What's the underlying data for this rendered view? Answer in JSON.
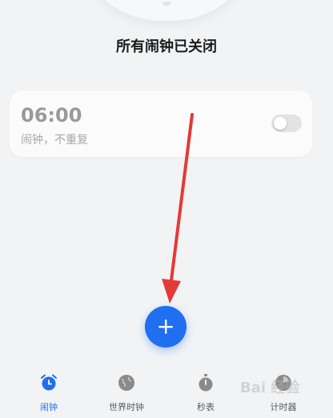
{
  "status": {
    "title": "所有闹钟已关闭"
  },
  "alarm": {
    "time": "06:00",
    "subtitle": "闹钟，不重复",
    "enabled": false
  },
  "add_button": {
    "icon": "plus-icon"
  },
  "tabs": [
    {
      "label": "闹钟",
      "icon": "alarm-clock-icon",
      "active": true
    },
    {
      "label": "世界时钟",
      "icon": "globe-icon",
      "active": false
    },
    {
      "label": "秒表",
      "icon": "stopwatch-icon",
      "active": false
    },
    {
      "label": "计时器",
      "icon": "timer-icon",
      "active": false
    }
  ],
  "watermark": "Bai 经验",
  "colors": {
    "accent": "#1f6ff0",
    "annotation_arrow": "#e53935"
  }
}
